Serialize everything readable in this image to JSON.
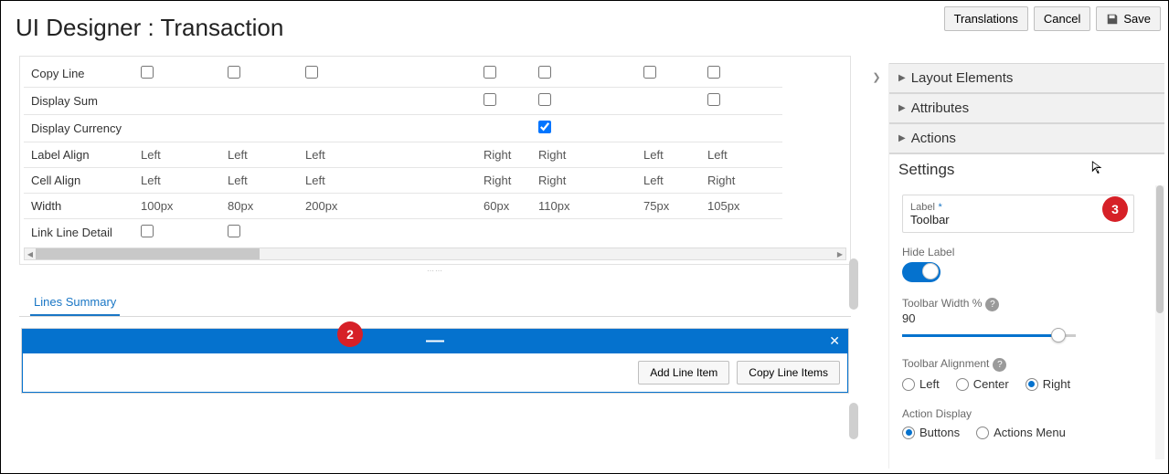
{
  "header": {
    "title": "UI Designer : Transaction",
    "buttons": {
      "translations": "Translations",
      "cancel": "Cancel",
      "save": "Save"
    }
  },
  "callouts": {
    "two": "2",
    "three": "3"
  },
  "grid": {
    "rows": [
      {
        "label": "Copy Line",
        "c1": "☐",
        "c2": "☐",
        "c3": "☐",
        "c4": "☐",
        "c5": "☐",
        "c6": "☐",
        "c7": "☐"
      },
      {
        "label": "Display Sum",
        "c1": "",
        "c2": "",
        "c3": "",
        "c4": "☐",
        "c5": "☐",
        "c6": "",
        "c7": "☐"
      },
      {
        "label": "Display Currency",
        "c1": "",
        "c2": "",
        "c3": "",
        "c4": "",
        "c5": "☑",
        "c6": "",
        "c7": ""
      },
      {
        "label": "Label Align",
        "c1": "Left",
        "c2": "Left",
        "c3": "Left",
        "c4": "Right",
        "c5": "Right",
        "c6": "Left",
        "c7": "Left"
      },
      {
        "label": "Cell Align",
        "c1": "Left",
        "c2": "Left",
        "c3": "Left",
        "c4": "Right",
        "c5": "Right",
        "c6": "Left",
        "c7": "Right"
      },
      {
        "label": "Width",
        "c1": "100px",
        "c2": "80px",
        "c3": "200px",
        "c4": "60px",
        "c5": "110px",
        "c6": "75px",
        "c7": "105px"
      },
      {
        "label": "Link Line Detail",
        "c1": "☐",
        "c2": "☐",
        "c3": "",
        "c4": "",
        "c5": "",
        "c6": "",
        "c7": ""
      }
    ]
  },
  "summary": {
    "tab_label": "Lines Summary",
    "buttons": {
      "add": "Add Line Item",
      "copy": "Copy Line Items"
    }
  },
  "right_panel": {
    "sections": {
      "layout_elements": "Layout Elements",
      "attributes": "Attributes",
      "actions": "Actions",
      "settings": "Settings"
    },
    "settings": {
      "label_field_label": "Label",
      "label_required": "*",
      "label_value": "Toolbar",
      "hide_label_label": "Hide Label",
      "hide_label_value": true,
      "toolbar_width_label": "Toolbar Width %",
      "toolbar_width_value": "90",
      "toolbar_alignment_label": "Toolbar Alignment",
      "alignment_options": {
        "left": "Left",
        "center": "Center",
        "right": "Right"
      },
      "alignment_selected": "right",
      "action_display_label": "Action Display",
      "action_display_options": {
        "buttons": "Buttons",
        "menu": "Actions Menu"
      },
      "action_display_selected": "buttons"
    }
  }
}
